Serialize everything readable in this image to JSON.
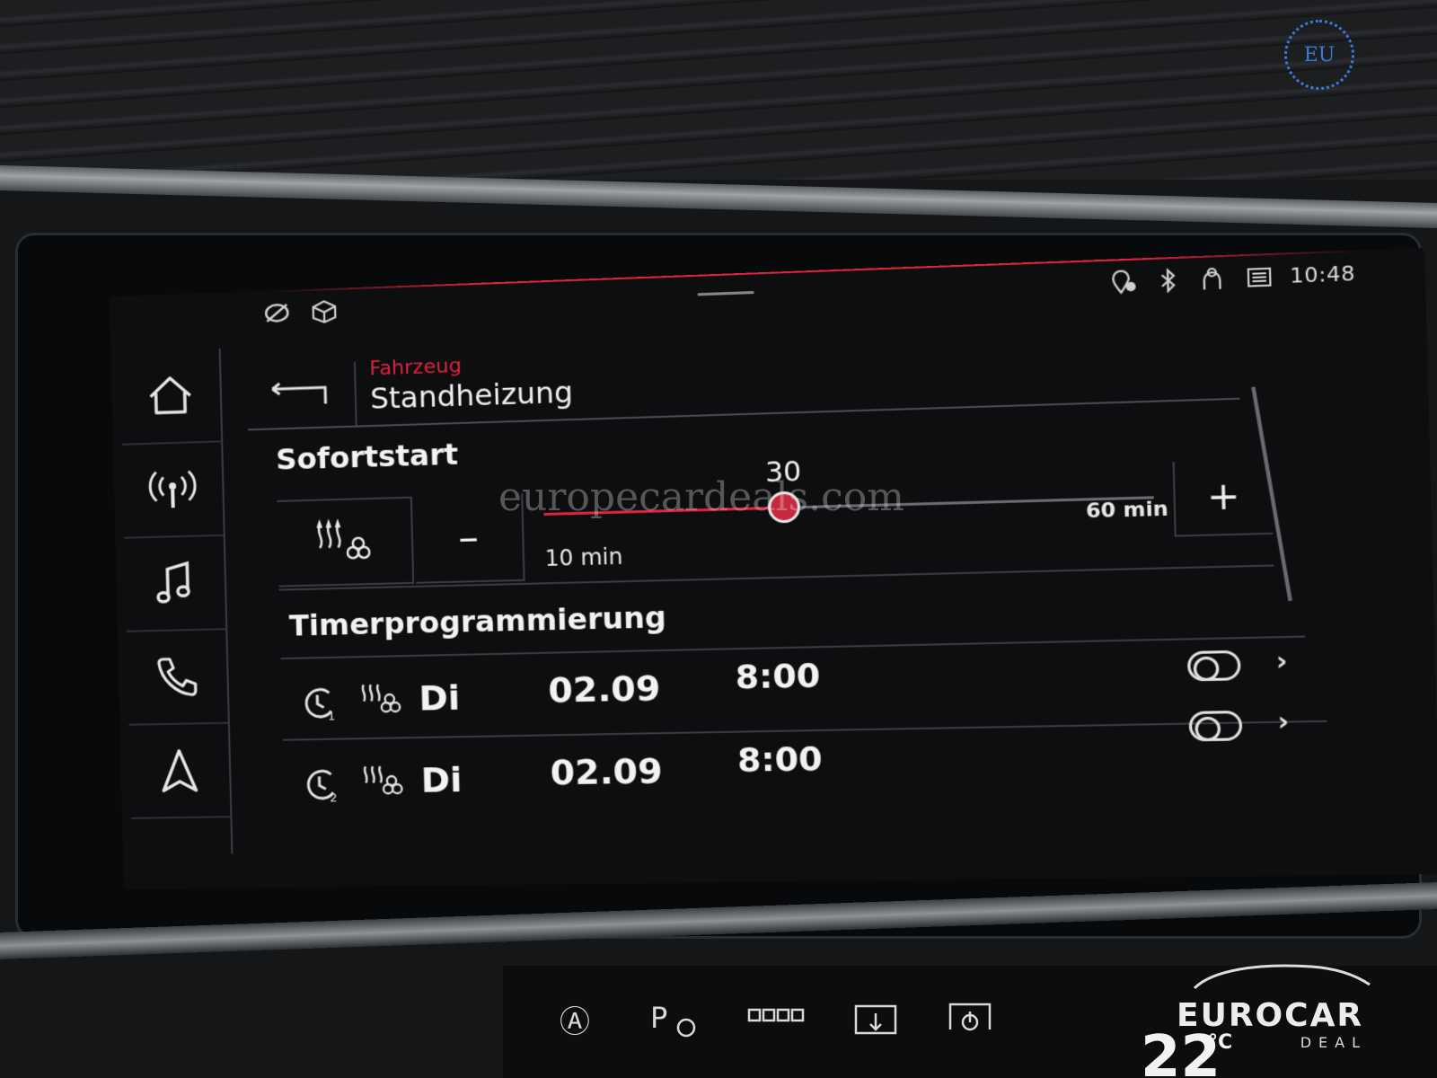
{
  "status_bar": {
    "time": "10:48",
    "left_icons": [
      "connect-icon",
      "cube-icon"
    ],
    "right_icons": [
      "location-warning-icon",
      "bluetooth-icon",
      "passenger-icon",
      "battery-icon"
    ]
  },
  "nav": {
    "items": [
      {
        "icon": "home-icon"
      },
      {
        "icon": "radio-antenna-icon"
      },
      {
        "icon": "music-note-icon"
      },
      {
        "icon": "phone-icon"
      },
      {
        "icon": "navigation-arrow-icon"
      }
    ]
  },
  "header": {
    "breadcrumb": "Fahrzeug",
    "title": "Standheizung"
  },
  "sofortstart": {
    "title": "Sofortstart",
    "minus_label": "–",
    "plus_label": "+",
    "slider": {
      "value": 30,
      "value_label": "30",
      "min": 10,
      "max": 60,
      "min_label": "10 min",
      "max_label": "60 min"
    }
  },
  "timer": {
    "title": "Timerprogrammierung",
    "rows": [
      {
        "day": "Di",
        "date": "02.09",
        "time": "8:00",
        "enabled": false,
        "index": "1"
      },
      {
        "day": "Di",
        "date": "02.09",
        "time": "8:00",
        "enabled": false,
        "index": "2"
      }
    ]
  },
  "watermark": {
    "site": "europecardeals.com",
    "badge": "EU",
    "brand_main": "EUROCAR",
    "brand_sub": "DEAL"
  },
  "climate": {
    "temperature": "22",
    "unit": "°C"
  },
  "colors": {
    "accent": "#e0233e",
    "background": "#0c0e10",
    "text": "#f2f2f2"
  }
}
